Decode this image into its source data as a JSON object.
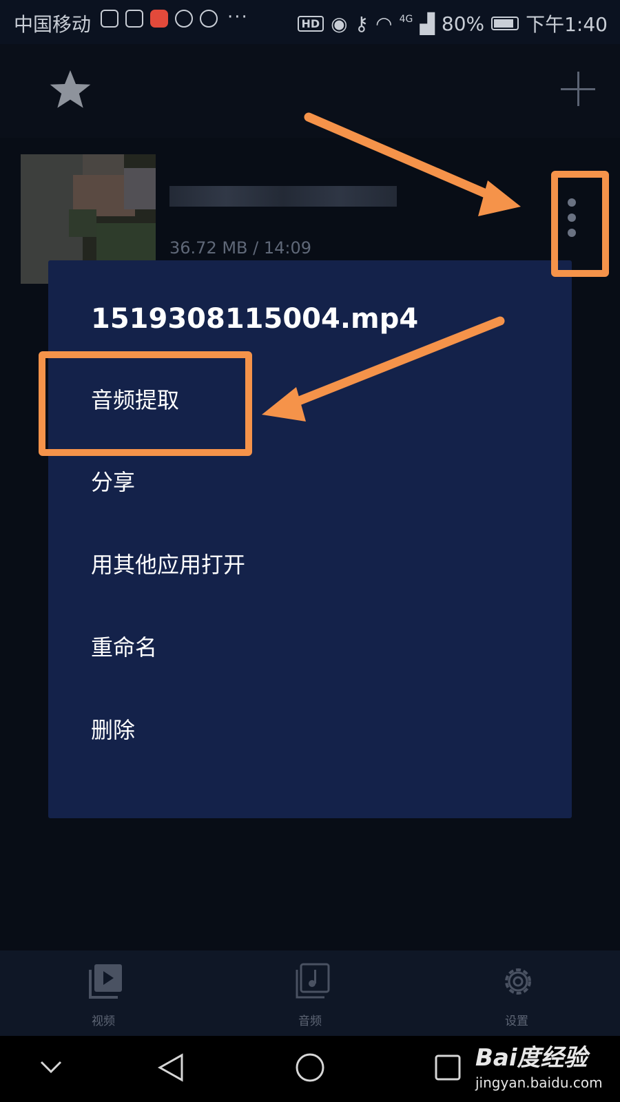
{
  "status_bar": {
    "carrier": "中国移动",
    "more_indicator": "···",
    "hd_badge": "HD",
    "network": "4G",
    "battery_percent": "80%",
    "time": "下午1:40"
  },
  "header": {
    "icons": [
      "star-icon",
      "plus-icon"
    ]
  },
  "file_item": {
    "size_duration": "36.72 MB / 14:09"
  },
  "dialog": {
    "title": "1519308115004.mp4",
    "items": [
      {
        "label": "音频提取"
      },
      {
        "label": "分享"
      },
      {
        "label": "用其他应用打开"
      },
      {
        "label": "重命名"
      },
      {
        "label": "删除"
      }
    ]
  },
  "bottom_nav": {
    "tabs": [
      {
        "label": "视频",
        "icon": "video-library-icon"
      },
      {
        "label": "音频",
        "icon": "music-library-icon"
      },
      {
        "label": "设置",
        "icon": "gear-icon"
      }
    ]
  },
  "watermark": {
    "brand": "Bai度经验",
    "site": "jingyan.baidu.com"
  },
  "colors": {
    "background": "#0a0f19",
    "dialog": "#14224a",
    "annotation": "#f5934a"
  }
}
